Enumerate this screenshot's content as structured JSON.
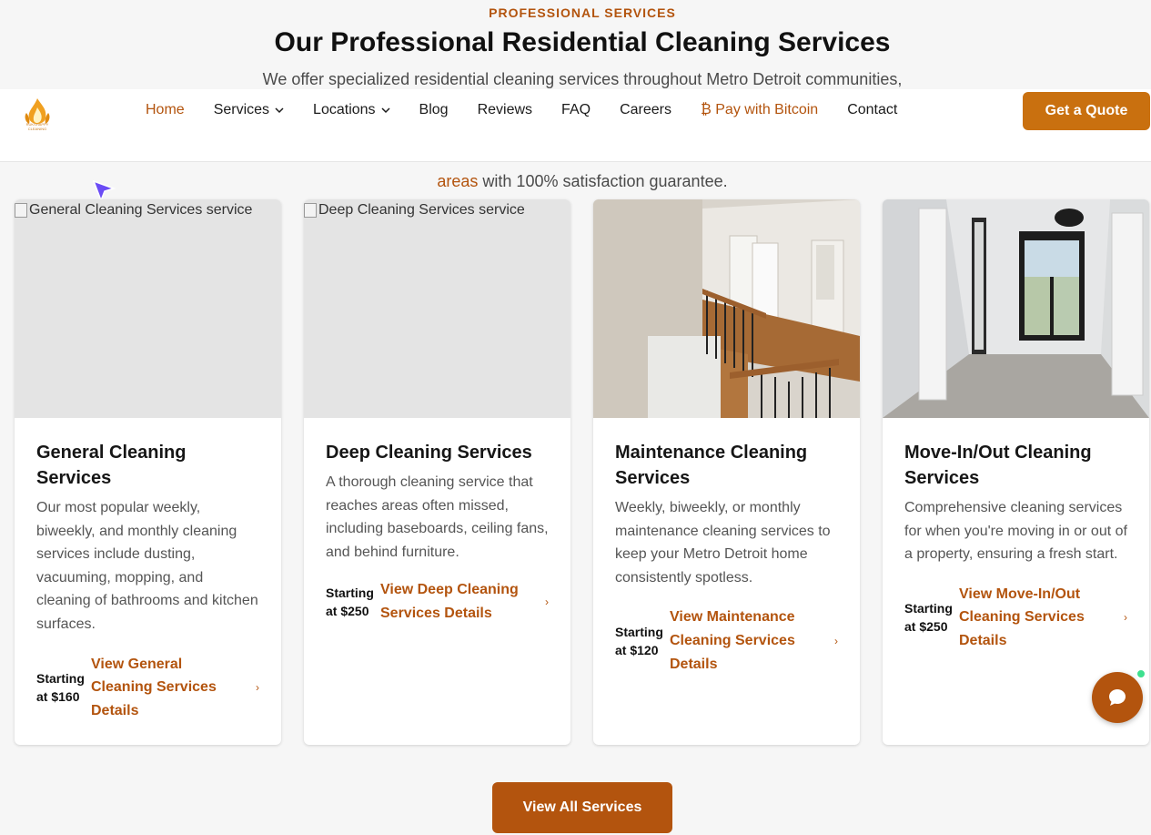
{
  "section": {
    "eyebrow": "PROFESSIONAL SERVICES",
    "title": "Our Professional Residential Cleaning Services",
    "lead_line1": "We offer specialized residential cleaning services throughout Metro Detroit communities,",
    "lead_line2_link": "areas",
    "lead_line2_rest": " with 100% satisfaction guarantee."
  },
  "header": {
    "logo_text": "RUKSHAPPY CLEANING",
    "nav": [
      {
        "label": "Home",
        "active": true
      },
      {
        "label": "Services",
        "dropdown": true
      },
      {
        "label": "Locations",
        "dropdown": true
      },
      {
        "label": "Blog"
      },
      {
        "label": "Reviews"
      },
      {
        "label": "FAQ"
      },
      {
        "label": "Careers"
      },
      {
        "label": "₿ Pay with Bitcoin"
      },
      {
        "label": "Contact"
      }
    ],
    "cta": "Get a Quote"
  },
  "cards": [
    {
      "alt": "General Cleaning Services service",
      "title": "General Cleaning Services",
      "desc": "Our most popular weekly, biweekly, and monthly cleaning services include dusting, vacuuming, mopping, and cleaning of bathrooms and kitchen surfaces.",
      "price": "Starting at $160",
      "link": "View General Cleaning Services Details"
    },
    {
      "alt": "Deep Cleaning Services service",
      "title": "Deep Cleaning Services",
      "desc": "A thorough cleaning service that reaches areas often missed, including baseboards, ceiling fans, and behind furniture.",
      "price": "Starting at $250",
      "link": "View Deep Cleaning Services Details"
    },
    {
      "alt": "Maintenance Cleaning Services service",
      "title": "Maintenance Cleaning Services",
      "desc": "Weekly, biweekly, or monthly maintenance cleaning services to keep your Metro Detroit home consistently spotless.",
      "price": "Starting at $120",
      "link": "View Maintenance Cleaning Services Details"
    },
    {
      "alt": "Move-In/Out Cleaning Services service",
      "title": "Move-In/Out Cleaning Services",
      "desc": "Comprehensive cleaning services for when you're moving in or out of a property, ensuring a fresh start.",
      "price": "Starting at $250",
      "link": "View Move-In/Out Cleaning Services Details"
    }
  ],
  "arrow_glyph": "›",
  "view_all": "View All Services",
  "colors": {
    "accent": "#b3540e",
    "cta": "#c9700f",
    "chat_online": "#3ee08f"
  },
  "icons": [
    "logo-flame-icon",
    "chevron-down-icon",
    "cursor-arrow-icon",
    "chat-bubble-icon",
    "broken-image-icon"
  ]
}
